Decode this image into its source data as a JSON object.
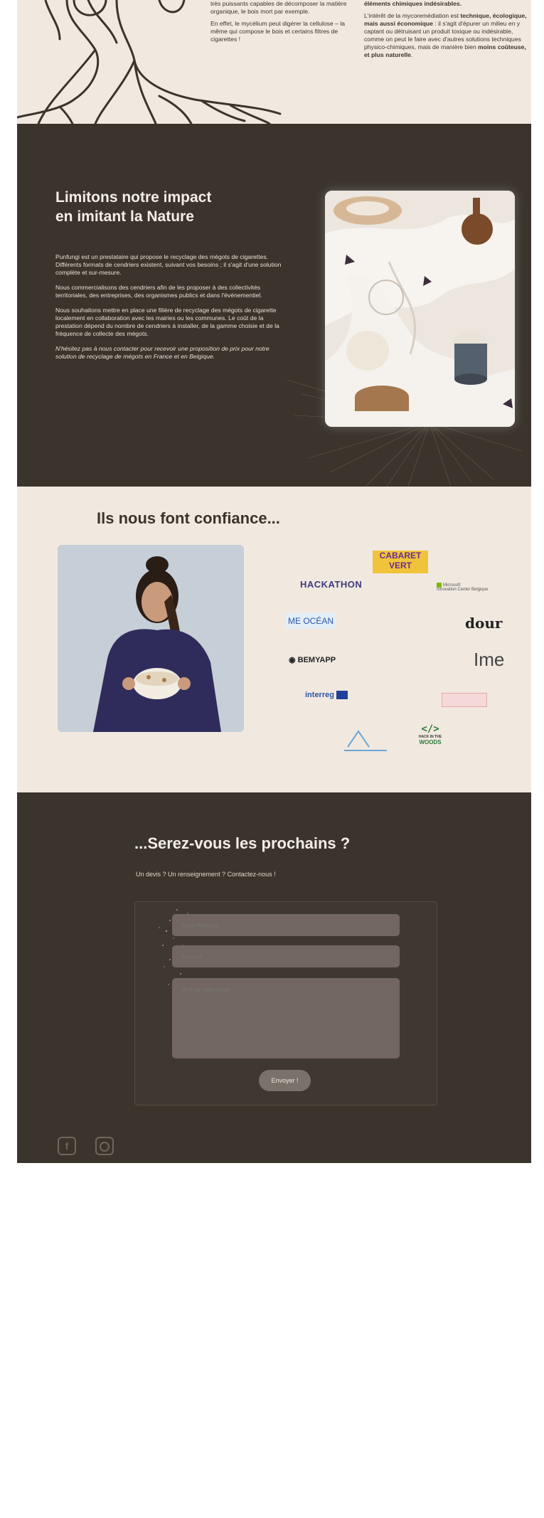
{
  "intro": {
    "col1": [
      "très puissants capables de décomposer la matière organique, le bois mort par exemple.",
      "En effet, le mycélium peut digérer la cellulose – la même qui compose le bois et certains filtres de cigarettes !"
    ],
    "col2_top": "éléments chimiques indésirables.",
    "col2_p2_a": "L'intérêt de la mycoremédiation est ",
    "col2_p2_b": "technique, écologique, mais aussi économique",
    "col2_p2_c": " : il s'agit d'épurer un milieu en y captant ou détruisant un produit toxique ou indésirable, comme on peut le faire avec d'autres solutions techniques physico-chimiques, mais de manière bien ",
    "col2_p2_d": "moins coûteuse, et plus naturelle",
    "col2_p2_e": "."
  },
  "impact": {
    "title_line1": "Limitons notre impact",
    "title_line2": "en imitant la Nature",
    "paragraphs": [
      "Punfungi est un prestataire qui propose le recyclage des mégots de cigarettes. Différents formats de cendriers existent, suivant vos besoins ; il s'agit d'une solution complète et sur-mesure.",
      "Nous commercialisons des cendriers afin de les proposer à des collectivités territoriales, des entreprises, des organismes publics et dans l'événementiel.",
      "Nous souhaitons mettre en place une filière de recyclage des mégots de cigarette localement en collaboration avec les mairies ou les communes. Le coût de la prestation dépend du nombre de cendriers à installer, de la gamme choisie et de la fréquence de collecte des mégots.",
      "N'hésitez pas à nous contacter pour recevoir une proposition de prix pour notre solution de recyclage de mégots en France et en Belgique."
    ]
  },
  "trust": {
    "title": "Ils nous font confiance...",
    "logos": {
      "cabaret1": "CABARET",
      "cabaret2": "VERT",
      "hackathon": "HACKATHON",
      "microsoft": "Microsoft",
      "microsoft_sub": "Innovation Center Belgique",
      "meocean": "ME OCÉAN",
      "dour": "dour",
      "bemyapp": "BEMYAPP",
      "ime": "Ime",
      "interreg": "interreg",
      "hack1": "HACK IN THE",
      "hack2": "WOODS"
    }
  },
  "contact": {
    "title": "...Serez-vous les prochains ?",
    "subtitle": "Un devis ? Un renseignement ? Contactez-nous !",
    "name_placeholder": "Nom Prénom",
    "company_placeholder": "Société",
    "message_placeholder": "Votre message",
    "send_label": "Envoyer !"
  },
  "colors": {
    "dark_bg": "#3b342d",
    "light_bg": "#f1e9e0",
    "field_bg": "#716760"
  },
  "social": {
    "facebook_icon": "facebook-icon",
    "instagram_icon": "instagram-icon"
  }
}
